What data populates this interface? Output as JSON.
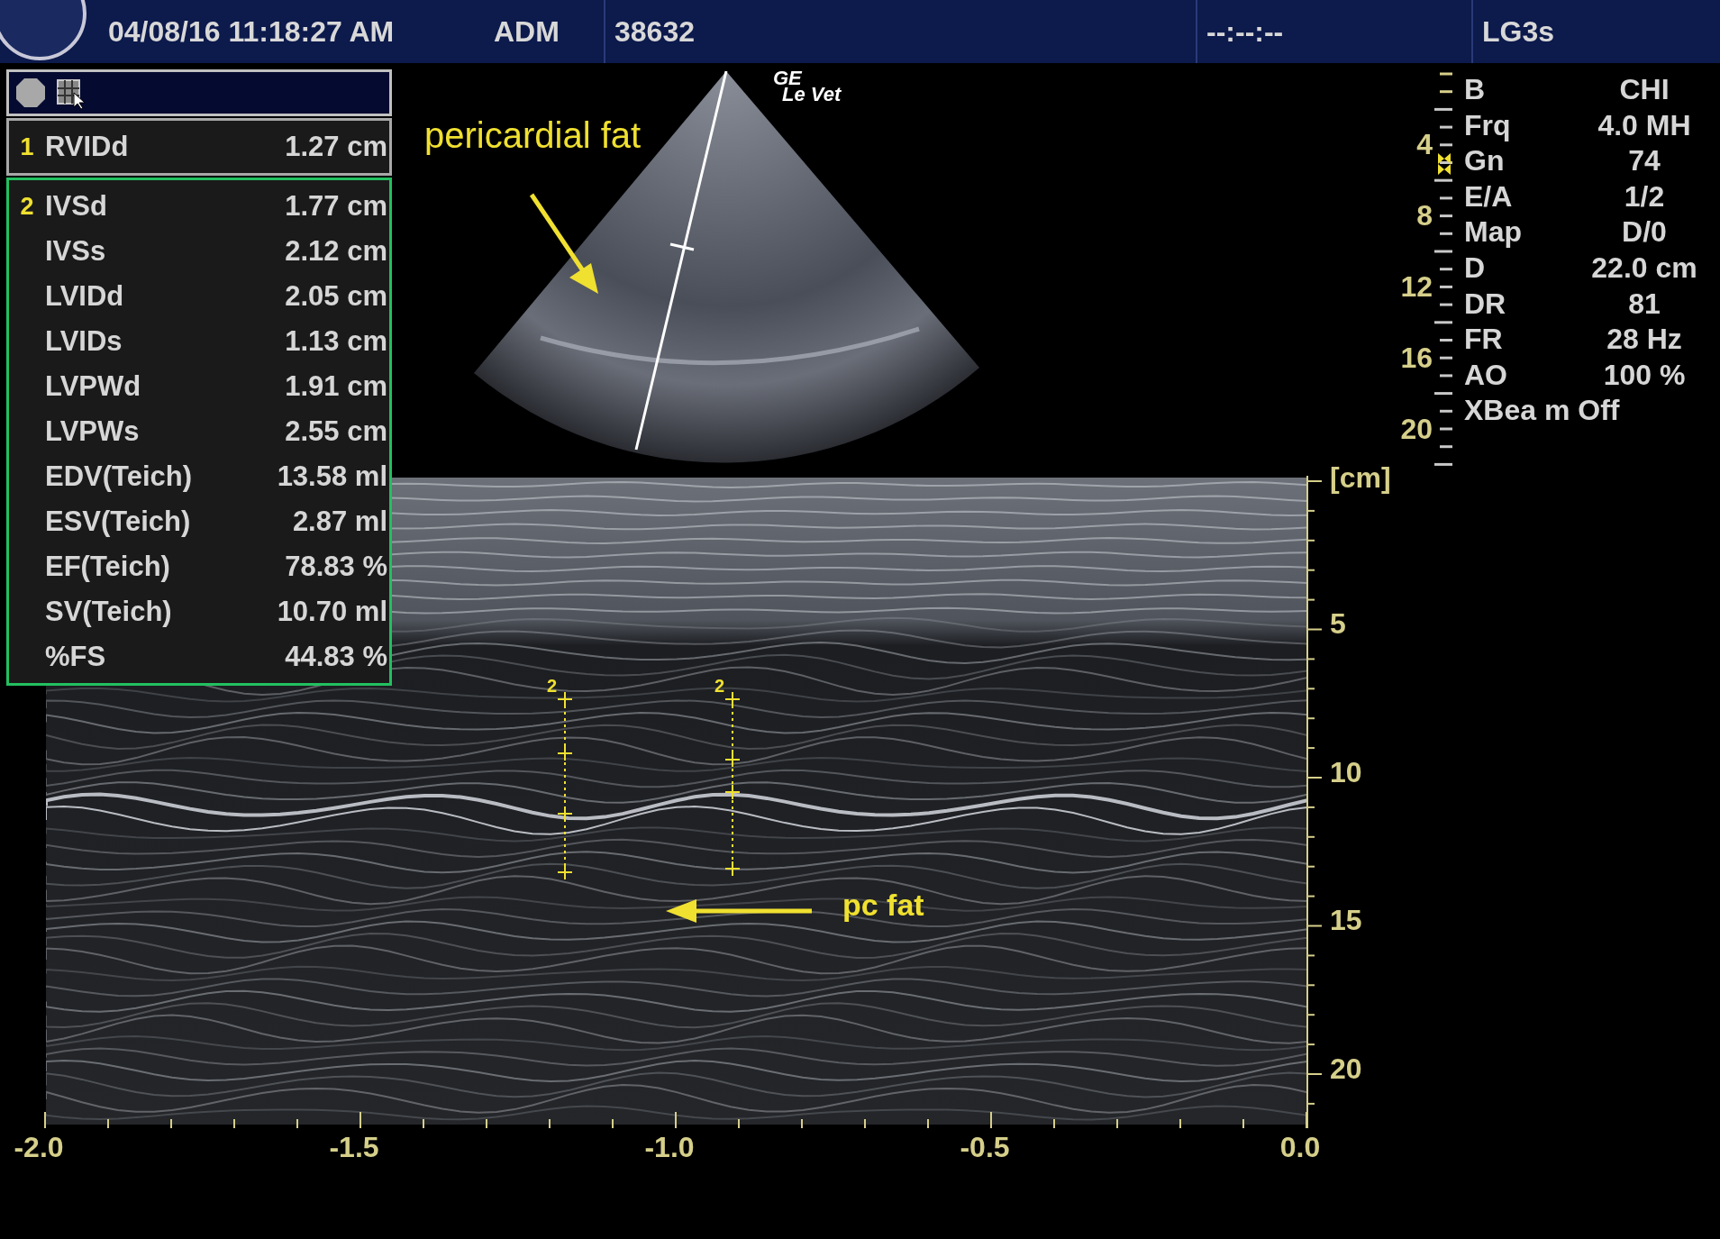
{
  "top_bar": {
    "items": [
      "04/08/16 11:18:27 AM",
      "ADM",
      "38632",
      "--:--:--",
      "LG3s"
    ]
  },
  "measurements": {
    "groups": [
      {
        "number": "1",
        "selected": false,
        "rows": [
          {
            "label": "RVIDd",
            "value": "1.27 cm"
          }
        ]
      },
      {
        "number": "2",
        "selected": true,
        "rows": [
          {
            "label": "IVSd",
            "value": "1.77 cm"
          },
          {
            "label": "IVSs",
            "value": "2.12 cm"
          },
          {
            "label": "LVIDd",
            "value": "2.05 cm"
          },
          {
            "label": "LVIDs",
            "value": "1.13 cm"
          },
          {
            "label": "LVPWd",
            "value": "1.91 cm"
          },
          {
            "label": "LVPWs",
            "value": "2.55 cm"
          },
          {
            "label": "EDV(Teich)",
            "value": "13.58 ml"
          },
          {
            "label": "ESV(Teich)",
            "value": "2.87 ml"
          },
          {
            "label": "EF(Teich)",
            "value": "78.83 %"
          },
          {
            "label": "SV(Teich)",
            "value": "10.70 ml"
          },
          {
            "label": "%FS",
            "value": "44.83 %"
          }
        ]
      }
    ]
  },
  "sector_annotation": "pericardial fat",
  "probe_label": [
    "GE",
    "Le Vet"
  ],
  "depth_scale": [
    "4",
    "8",
    "12",
    "16",
    "20"
  ],
  "parameters": [
    {
      "label": "B",
      "value": "CHI"
    },
    {
      "label": "Frq",
      "value": "4.0 MH"
    },
    {
      "label": "Gn",
      "value": "74"
    },
    {
      "label": "E/A",
      "value": "1/2"
    },
    {
      "label": "Map",
      "value": "D/0"
    },
    {
      "label": "D",
      "value": "22.0 cm"
    },
    {
      "label": "DR",
      "value": "81"
    },
    {
      "label": "FR",
      "value": "28 Hz"
    },
    {
      "label": "AO",
      "value": "100 %"
    },
    {
      "label": "XBea m Off"
    }
  ],
  "mmode": {
    "depth_labels": [
      "[cm]",
      "5",
      "10",
      "15",
      "20"
    ],
    "time_labels": [
      "-2.0",
      "-1.5",
      "-1.0",
      "-0.5",
      "0.0"
    ],
    "caliper_labels": [
      "2",
      "2"
    ],
    "annotation": "pc fat"
  }
}
